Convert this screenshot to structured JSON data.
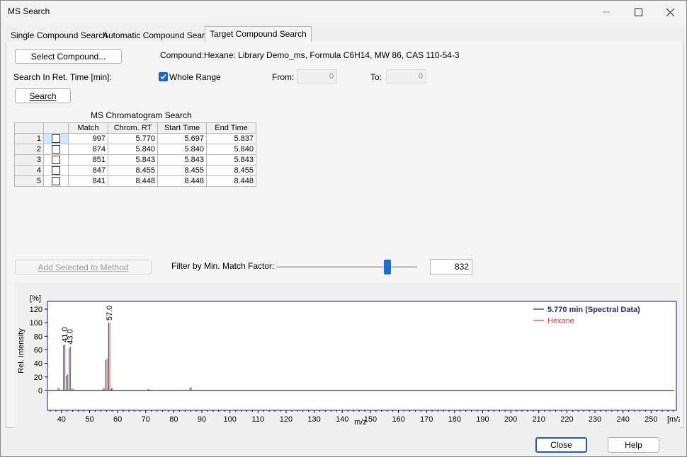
{
  "window": {
    "title": "MS Search"
  },
  "tabs": [
    {
      "label": "Single Compound Search"
    },
    {
      "label": "Automatic Compound Search"
    },
    {
      "label": "Target Compound Search",
      "active": true
    }
  ],
  "target": {
    "select_button": "Select Compound...",
    "compound_label": "Compound:",
    "compound_value": "Hexane: Library Demo_ms, Formula C6H14, MW 86, CAS 110-54-3",
    "search_in_label": "Search In Ret. Time [min]:",
    "whole_range_label": "Whole Range",
    "whole_range_checked": true,
    "from_label": "From:",
    "from_value": "0",
    "to_label": "To:",
    "to_value": "0",
    "search_button": "Search",
    "table_title": "MS Chromatogram Search",
    "table": {
      "columns": [
        "Match",
        "Chrom. RT",
        "Start Time",
        "End Time"
      ],
      "rows": [
        {
          "n": "1",
          "match": "997",
          "rt": "5.770",
          "start": "5.697",
          "end": "5.837"
        },
        {
          "n": "2",
          "match": "874",
          "rt": "5.840",
          "start": "5.840",
          "end": "5.840"
        },
        {
          "n": "3",
          "match": "851",
          "rt": "5.843",
          "start": "5.843",
          "end": "5.843"
        },
        {
          "n": "4",
          "match": "847",
          "rt": "8.455",
          "start": "8.455",
          "end": "8.455"
        },
        {
          "n": "5",
          "match": "841",
          "rt": "8.448",
          "start": "8.448",
          "end": "8.448"
        }
      ]
    },
    "add_selected_button": "Add Selected to Method",
    "filter_label": "Filter by Min. Match Factor:",
    "filter_value": "832",
    "filter_slider_fraction": 0.79
  },
  "chart_data": {
    "type": "bar",
    "title": "",
    "xlabel": "m/z",
    "ylabel": "Rel. Intensity",
    "y_unit_label": "[%]",
    "x_unit_label": "[m/z]",
    "xlim": [
      35,
      259
    ],
    "ylim": [
      0,
      130
    ],
    "x_ticks": [
      40,
      50,
      60,
      70,
      80,
      90,
      100,
      110,
      120,
      130,
      140,
      150,
      160,
      170,
      180,
      190,
      200,
      210,
      220,
      230,
      240,
      250
    ],
    "y_ticks": [
      0,
      20,
      40,
      60,
      80,
      100,
      120
    ],
    "legend_position": "top-right",
    "series": [
      {
        "name": "5.770 min (Spectral Data)",
        "color": "#1f2d6b",
        "points": [
          [
            39,
            3
          ],
          [
            41,
            67
          ],
          [
            42,
            22
          ],
          [
            43,
            63
          ],
          [
            44,
            3
          ],
          [
            55,
            3
          ],
          [
            56,
            45
          ],
          [
            57,
            100
          ],
          [
            58,
            3
          ],
          [
            71,
            2
          ],
          [
            86,
            4
          ]
        ]
      },
      {
        "name": "Hexane",
        "color": "#d93b3b",
        "points": [
          [
            39,
            4
          ],
          [
            41,
            68
          ],
          [
            42,
            24
          ],
          [
            43,
            65
          ],
          [
            44,
            2
          ],
          [
            55,
            3
          ],
          [
            56,
            47
          ],
          [
            57,
            100
          ],
          [
            58,
            4
          ],
          [
            71,
            2
          ],
          [
            86,
            5
          ]
        ]
      }
    ],
    "peak_labels": [
      {
        "x": 41,
        "label": "41.0"
      },
      {
        "x": 43,
        "label": "43.0"
      },
      {
        "x": 57,
        "label": "57.0"
      }
    ]
  },
  "buttons": {
    "close": "Close",
    "help": "Help"
  }
}
